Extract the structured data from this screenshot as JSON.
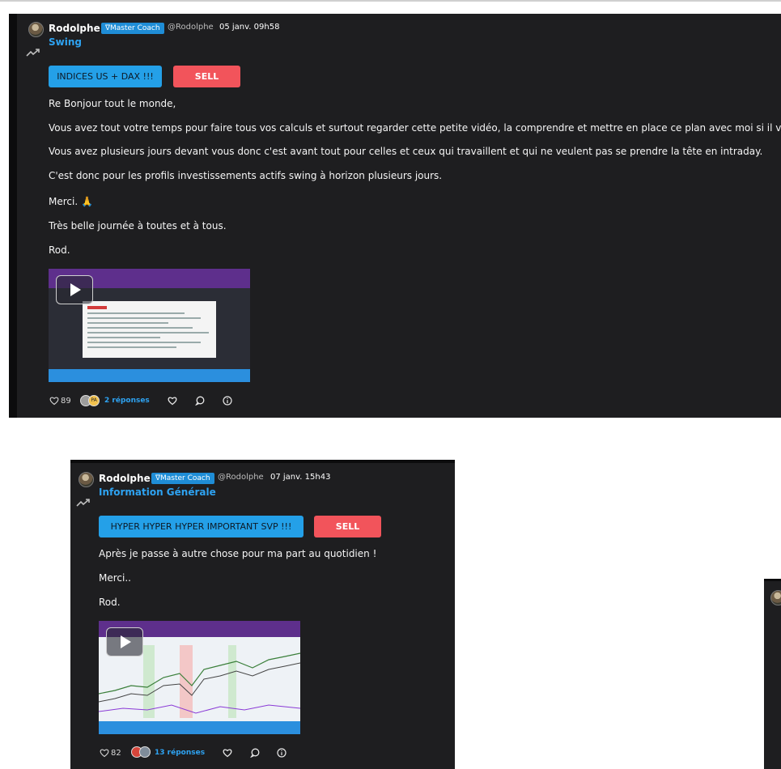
{
  "posts": [
    {
      "author": "Rodolphe",
      "badge": "∇Master Coach",
      "handle": "@Rodolphe",
      "date": "05 janv. 09h58",
      "category": "Swing",
      "tag": "INDICES US + DAX !!!",
      "action": "SELL",
      "paragraphs": [
        "Re Bonjour tout le monde,",
        "Vous avez tout votre temps pour faire tous vos calculs et surtout regarder cette petite vidéo, la comprendre et mettre en place ce plan avec moi si il vous int",
        "Vous avez plusieurs jours devant vous donc c'est avant tout pour celles et ceux qui travaillent et qui ne veulent pas se prendre la tête en intraday.",
        "C'est donc pour les profils investissements actifs swing à horizon plusieurs jours.",
        "Merci. 🙏",
        "Très belle journée à toutes et à tous.",
        "Rod."
      ],
      "likes": "89",
      "reply_avatar_initials": "PA",
      "replies": "2 réponses"
    },
    {
      "author": "Rodolphe",
      "badge": "∇Master Coach",
      "handle": "@Rodolphe",
      "date": "07 janv. 15h43",
      "category": "Information Générale",
      "tag": "HYPER HYPER HYPER IMPORTANT SVP !!!",
      "action": "SELL",
      "paragraphs": [
        "Après je passe à autre chose pour ma part au quotidien !",
        "Merci..",
        "Rod."
      ],
      "likes": "82",
      "replies": "13 réponses"
    }
  ],
  "icons": {
    "trend": "trending-up-icon",
    "like": "heart-icon",
    "reply": "comment-icon",
    "info": "info-icon",
    "play": "play-icon"
  },
  "colors": {
    "card": "#1e1e20",
    "accent": "#2ea3f2",
    "tag": "#24a0e8",
    "sell": "#f2545b",
    "badge": "#1f8dd6"
  }
}
